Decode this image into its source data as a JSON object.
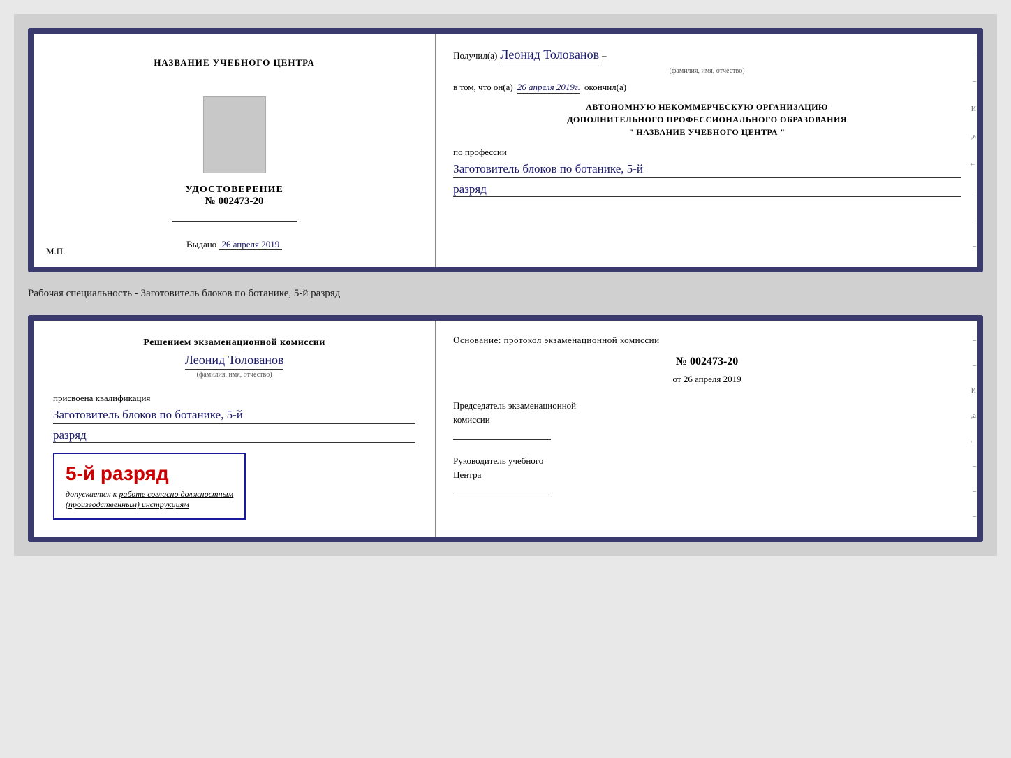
{
  "page": {
    "background": "#d0d0d0"
  },
  "top_card": {
    "left": {
      "header": "НАЗВАНИЕ УЧЕБНОГО ЦЕНТРА",
      "title": "УДОСТОВЕРЕНИЕ",
      "number_prefix": "№",
      "number": "002473-20",
      "vydano_label": "Выдано",
      "vydano_date": "26 апреля 2019",
      "mp_label": "М.П."
    },
    "right": {
      "poluchil_label": "Получил(а)",
      "name": "Леонид Толованов",
      "name_sub": "(фамилия, имя, отчество)",
      "vtom_prefix": "в том, что он(а)",
      "vtom_date": "26 апреля 2019г.",
      "okончил_label": "окончил(а)",
      "org_line1": "АВТОНОМНУЮ НЕКОММЕРЧЕСКУЮ ОРГАНИЗАЦИЮ",
      "org_line2": "ДОПОЛНИТЕЛЬНОГО ПРОФЕССИОНАЛЬНОГО ОБРАЗОВАНИЯ",
      "org_line3": "\"   НАЗВАНИЕ УЧЕБНОГО ЦЕНТРА   \"",
      "po_professii": "по профессии",
      "profession": "Заготовитель блоков по ботанике, 5-й",
      "razryad": "разряд"
    }
  },
  "between_label": "Рабочая специальность - Заготовитель блоков по ботанике, 5-й разряд",
  "bottom_card": {
    "left": {
      "resheniyem": "Решением экзаменационной комиссии",
      "name": "Леонид Толованов",
      "name_sub": "(фамилия, имя, отчество)",
      "prisvoena": "присвоена квалификация",
      "profession": "Заготовитель блоков по ботанике, 5-й",
      "razryad_text": "разряд",
      "razryad_box_big": "5-й разряд",
      "dopuskaetsya": "допускается к",
      "rabote": "работе согласно должностным",
      "instruktsiyam": "(производственным) инструкциям"
    },
    "right": {
      "osnovanie": "Основание: протокол экзаменационной комиссии",
      "number_prefix": "№",
      "number": "002473-20",
      "ot_prefix": "от",
      "ot_date": "26 апреля 2019",
      "predsedatel_line1": "Председатель экзаменационной",
      "predsedatel_line2": "комиссии",
      "rukovoditel_line1": "Руководитель учебного",
      "rukovoditel_line2": "Центра"
    }
  }
}
